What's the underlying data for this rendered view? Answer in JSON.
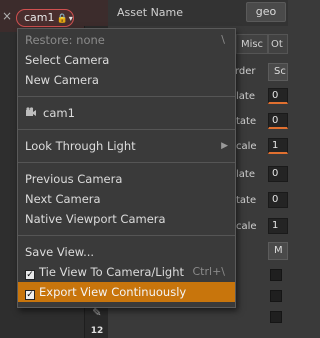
{
  "viewport": {
    "close_glyph": "×",
    "camera_pill": {
      "name": "cam1",
      "lock_glyph": "🔒",
      "drop_glyph": "▾"
    },
    "toolbar_badge": "12"
  },
  "panel": {
    "asset_label": "Asset Name",
    "asset_value": "geo",
    "tabs": [
      "Misc",
      "Ot"
    ],
    "rows": [
      {
        "label": "rder",
        "kind": "button",
        "value": "Sc"
      },
      {
        "label": "late",
        "kind": "field",
        "value": "0",
        "accent": true
      },
      {
        "label": "tate",
        "kind": "field",
        "value": "0",
        "accent": true
      },
      {
        "label": "cale",
        "kind": "field",
        "value": "1",
        "accent": true
      },
      {
        "label": "late",
        "kind": "field",
        "value": "0",
        "accent": false
      },
      {
        "label": "tate",
        "kind": "field",
        "value": "0",
        "accent": false
      },
      {
        "label": "cale",
        "kind": "field",
        "value": "1",
        "accent": false
      }
    ],
    "extra_button": "M"
  },
  "menu": {
    "restore": "Restore: none",
    "restore_shortcut": "\\",
    "select_camera": "Select Camera",
    "new_camera": "New Camera",
    "camera_item": "cam1",
    "look_through_light": "Look Through Light",
    "previous_camera": "Previous Camera",
    "next_camera": "Next Camera",
    "native_viewport_camera": "Native Viewport Camera",
    "save_view": "Save View...",
    "tie_view": "Tie View To Camera/Light",
    "tie_view_shortcut": "Ctrl+\\",
    "tie_view_checked": true,
    "export_view": "Export View Continuously",
    "export_view_checked": true,
    "highlight_color": "#c8750c"
  }
}
